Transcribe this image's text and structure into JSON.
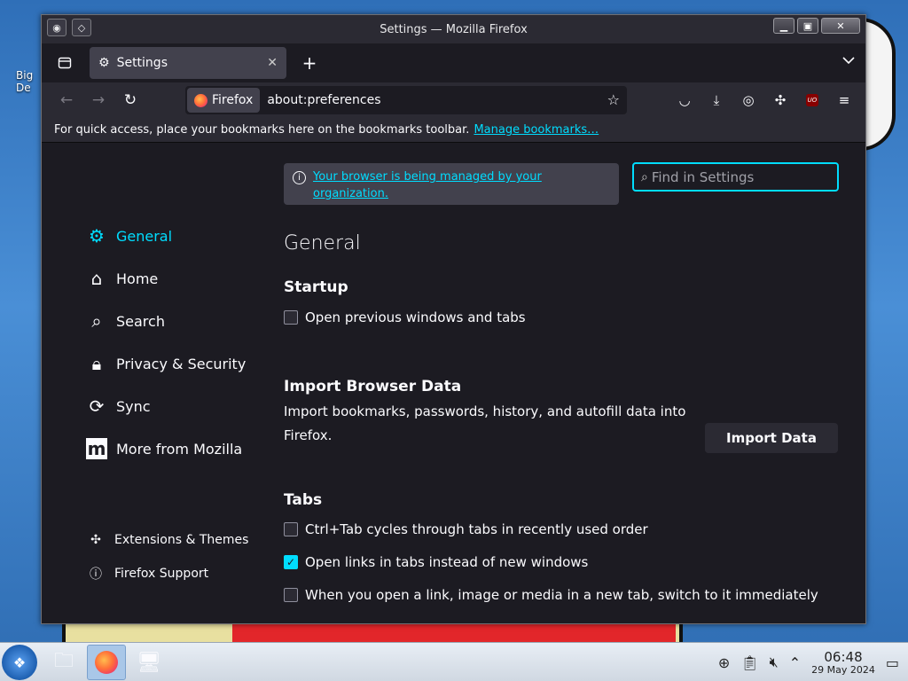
{
  "desktop": {
    "icon_label": "Big\nDe"
  },
  "window": {
    "title": "Settings — Mozilla Firefox"
  },
  "tab": {
    "label": "Settings"
  },
  "urlbar": {
    "identity": "Firefox",
    "url": "about:preferences"
  },
  "bookmarks_bar": {
    "message": "For quick access, place your bookmarks here on the bookmarks toolbar.",
    "link": "Manage bookmarks…"
  },
  "notice": {
    "managed": "Your browser is being managed by your organization."
  },
  "search": {
    "placeholder": "Find in Settings"
  },
  "sidebar": {
    "categories": [
      {
        "label": "General",
        "icon": "gear-icon",
        "active": true
      },
      {
        "label": "Home",
        "icon": "home-icon"
      },
      {
        "label": "Search",
        "icon": "search-icon"
      },
      {
        "label": "Privacy & Security",
        "icon": "lock-icon"
      },
      {
        "label": "Sync",
        "icon": "sync-icon"
      },
      {
        "label": "More from Mozilla",
        "icon": "mozilla-icon"
      }
    ],
    "bottom": [
      {
        "label": "Extensions & Themes",
        "icon": "puzzle-icon"
      },
      {
        "label": "Firefox Support",
        "icon": "help-icon"
      }
    ]
  },
  "main": {
    "heading": "General",
    "startup": {
      "heading": "Startup",
      "restore_session": "Open previous windows and tabs",
      "restore_checked": false
    },
    "import": {
      "heading": "Import Browser Data",
      "description": "Import bookmarks, passwords, history, and autofill data into Firefox.",
      "button": "Import Data"
    },
    "tabs": {
      "heading": "Tabs",
      "options": [
        {
          "label": "Ctrl+Tab cycles through tabs in recently used order",
          "checked": false
        },
        {
          "label": "Open links in tabs instead of new windows",
          "checked": true
        },
        {
          "label": "When you open a link, image or media in a new tab, switch to it immediately",
          "checked": false
        }
      ]
    }
  },
  "taskbar": {
    "time": "06:48",
    "date": "29 May 2024"
  },
  "colors": {
    "accent": "#00ddff",
    "background": "#1c1b22",
    "toolbar": "#2b2a33"
  }
}
